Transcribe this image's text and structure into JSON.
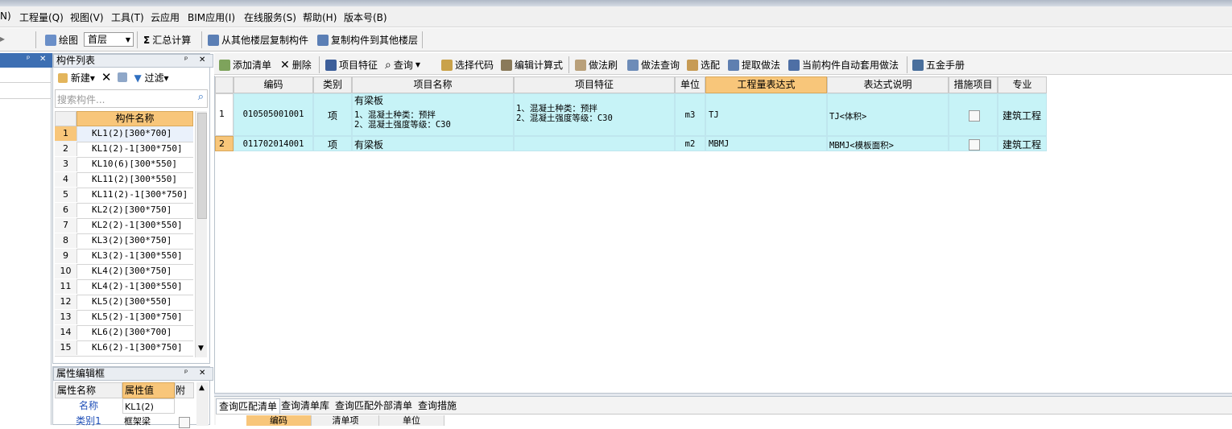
{
  "menu": [
    "N)",
    "工程量(Q)",
    "视图(V)",
    "工具(T)",
    "云应用",
    "BIM应用(I)",
    "在线服务(S)",
    "帮助(H)",
    "版本号(B)"
  ],
  "toolbar": {
    "draw_label": "绘图",
    "floor_value": "首层",
    "sum_label": "汇总计算",
    "copy_from_label": "从其他楼层复制构件",
    "copy_to_label": "复制构件到其他楼层"
  },
  "component_panel": {
    "title": "构件列表",
    "new_label": "新建",
    "filter_label": "过滤",
    "search_placeholder": "搜索构件...",
    "col_name": "构件名称",
    "rows": [
      {
        "num": "1",
        "name": "KL1(2)[300*700]"
      },
      {
        "num": "2",
        "name": "KL1(2)-1[300*750]"
      },
      {
        "num": "3",
        "name": "KL10(6)[300*550]"
      },
      {
        "num": "4",
        "name": "KL11(2)[300*550]"
      },
      {
        "num": "5",
        "name": "KL11(2)-1[300*750]"
      },
      {
        "num": "6",
        "name": "KL2(2)[300*750]"
      },
      {
        "num": "7",
        "name": "KL2(2)-1[300*550]"
      },
      {
        "num": "8",
        "name": "KL3(2)[300*750]"
      },
      {
        "num": "9",
        "name": "KL3(2)-1[300*550]"
      },
      {
        "num": "10",
        "name": "KL4(2)[300*750]"
      },
      {
        "num": "11",
        "name": "KL4(2)-1[300*550]"
      },
      {
        "num": "12",
        "name": "KL5(2)[300*550]"
      },
      {
        "num": "13",
        "name": "KL5(2)-1[300*750]"
      },
      {
        "num": "14",
        "name": "KL6(2)[300*700]"
      },
      {
        "num": "15",
        "name": "KL6(2)-1[300*750]"
      }
    ]
  },
  "property_panel": {
    "title": "属性编辑框",
    "col_name": "属性名称",
    "col_value": "属性值",
    "col_extra": "附加",
    "rows": [
      {
        "name": "名称",
        "value": "KL1(2)"
      },
      {
        "name": "类别1",
        "value": "框架梁"
      }
    ]
  },
  "list_toolbar": {
    "add": "添加清单",
    "delete": "删除",
    "feature": "项目特征",
    "query": "查询",
    "select_code": "选择代码",
    "edit_formula": "编辑计算式",
    "method_brush": "做法刷",
    "method_query": "做法查询",
    "select_match": "选配",
    "extract": "提取做法",
    "auto_apply": "当前构件自动套用做法",
    "hardware": "五金手册"
  },
  "table": {
    "headers": [
      "编码",
      "类别",
      "项目名称",
      "项目特征",
      "单位",
      "工程量表达式",
      "表达式说明",
      "措施项目",
      "专业"
    ],
    "rows": [
      {
        "num": "1",
        "code": "010505001001",
        "type": "项",
        "name_lines": [
          "有梁板",
          "",
          "1、混凝土种类：预拌",
          "2、混凝土强度等级：C30"
        ],
        "feature_lines": [
          "1、混凝土种类：预拌",
          "2、混凝土强度等级：C30"
        ],
        "unit": "m3",
        "expr": "TJ",
        "expr_desc": "TJ<体积>",
        "measure": false,
        "discipline": "建筑工程"
      },
      {
        "num": "2",
        "code": "011702014001",
        "type": "项",
        "name_lines": [
          "有梁板"
        ],
        "feature_lines": [],
        "unit": "m2",
        "expr": "MBMJ",
        "expr_desc": "MBMJ<模板面积>",
        "measure": false,
        "discipline": "建筑工程"
      }
    ]
  },
  "bottom_tabs": [
    "查询匹配清单",
    "查询清单库",
    "查询匹配外部清单",
    "查询措施"
  ],
  "bottom_headers": [
    "编码",
    "清单项",
    "单位"
  ],
  "icons": [
    "pin-icon",
    "close-icon",
    "search-icon",
    "filter-icon",
    "delete-icon",
    "dropdown-arrow-icon"
  ],
  "colors": {
    "highlight_header": "#f8c67a",
    "row_highlight": "#c7f3f7",
    "selected_row": "#ffffff"
  }
}
